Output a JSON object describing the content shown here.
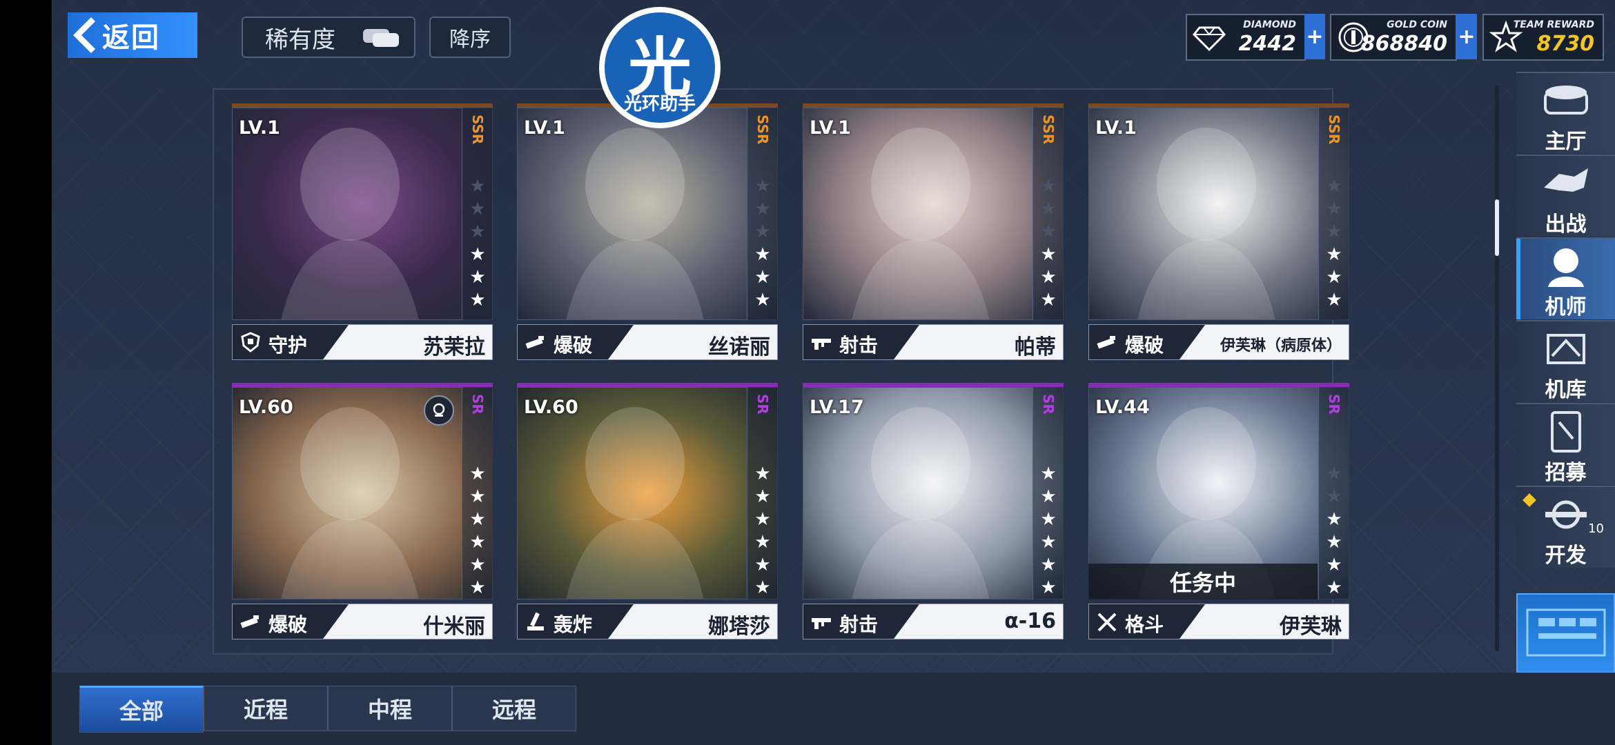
{
  "header": {
    "back_label": "返回",
    "rarity_label": "稀有度",
    "order_label": "降序"
  },
  "watermark": {
    "big": "光",
    "small": "光环助手"
  },
  "currencies": [
    {
      "name": "DIAMOND",
      "value": "2442",
      "icon": "diamond-icon"
    },
    {
      "name": "GOLD COIN",
      "value": "868840",
      "icon": "gold-coin-icon"
    },
    {
      "name": "TEAM REWARD",
      "value": "8730",
      "icon": "team-reward-icon"
    }
  ],
  "colors": {
    "accent": "#3390ff",
    "ssr": "#e8942c",
    "sr": "#b13fe0",
    "team_reward": "#f3c623"
  },
  "cards": [
    {
      "level": "LV.1",
      "rarity": "SSR",
      "stars_filled": 3,
      "stars_total": 6,
      "role": "守护",
      "role_icon": "shield-icon",
      "name": "苏茉拉",
      "mission": ""
    },
    {
      "level": "LV.1",
      "rarity": "SSR",
      "stars_filled": 3,
      "stars_total": 6,
      "role": "爆破",
      "role_icon": "blaster-icon",
      "name": "丝诺丽",
      "mission": ""
    },
    {
      "level": "LV.1",
      "rarity": "SSR",
      "stars_filled": 3,
      "stars_total": 6,
      "role": "射击",
      "role_icon": "rifle-icon",
      "name": "帕蒂",
      "mission": ""
    },
    {
      "level": "LV.1",
      "rarity": "SSR",
      "stars_filled": 3,
      "stars_total": 6,
      "role": "爆破",
      "role_icon": "blaster-icon",
      "name": "伊芙琳（病原体）",
      "mission": ""
    },
    {
      "level": "LV.60",
      "rarity": "SR",
      "stars_filled": 6,
      "stars_total": 6,
      "role": "爆破",
      "role_icon": "blaster-icon",
      "name": "什米丽",
      "mission": ""
    },
    {
      "level": "LV.60",
      "rarity": "SR",
      "stars_filled": 6,
      "stars_total": 6,
      "role": "轰炸",
      "role_icon": "mortar-icon",
      "name": "娜塔莎",
      "mission": ""
    },
    {
      "level": "LV.17",
      "rarity": "SR",
      "stars_filled": 6,
      "stars_total": 6,
      "role": "射击",
      "role_icon": "rifle-icon",
      "name": "α-16",
      "mission": ""
    },
    {
      "level": "LV.44",
      "rarity": "SR",
      "stars_filled": 4,
      "stars_total": 6,
      "role": "格斗",
      "role_icon": "crossed-swords-icon",
      "name": "伊芙琳",
      "mission": "任务中"
    }
  ],
  "side_nav": [
    {
      "label": "主厅",
      "icon": "lobby-icon",
      "active": false
    },
    {
      "label": "出战",
      "icon": "battle-icon",
      "active": false
    },
    {
      "label": "机师",
      "icon": "pilot-icon",
      "active": true
    },
    {
      "label": "机库",
      "icon": "hangar-icon",
      "active": false
    },
    {
      "label": "招募",
      "icon": "recruit-icon",
      "active": false
    },
    {
      "label": "开发",
      "icon": "develop-icon",
      "active": false,
      "badge": "10"
    }
  ],
  "tabs": [
    {
      "label": "全部",
      "active": true
    },
    {
      "label": "近程",
      "active": false
    },
    {
      "label": "中程",
      "active": false
    },
    {
      "label": "远程",
      "active": false
    }
  ]
}
